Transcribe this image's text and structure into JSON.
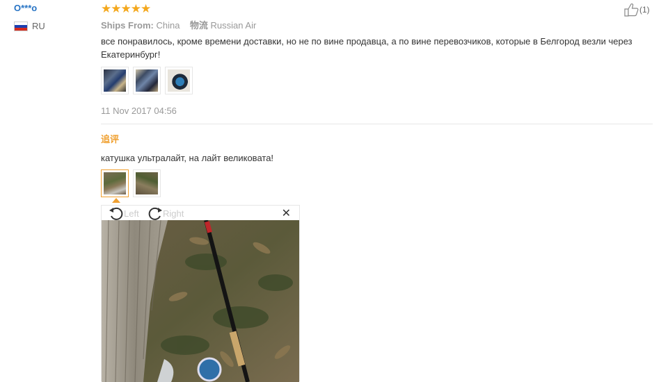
{
  "user": {
    "name": "O***o",
    "country": "RU"
  },
  "review": {
    "stars": "★★★★★",
    "rating": 5,
    "helpful_count": "(1)",
    "ships_from_label": "Ships From:",
    "ships_from_value": "China",
    "shipping_label": "物流",
    "shipping_value": "Russian Air",
    "text": "все понравилось, кроме времени доставки, но не по вине продавца, а по вине перевозчиков, которые в Белгород везли через Екатеринбург!",
    "date": "11 Nov 2017 04:56",
    "thumbnails": [
      "photo-1",
      "photo-2",
      "photo-3"
    ]
  },
  "followup": {
    "label": "追评",
    "text": "катушка ультралайт, на лайт великовата!",
    "thumbnails": [
      "photo-a",
      "photo-b"
    ]
  },
  "viewer": {
    "rotate_left_label": "Left",
    "rotate_right_label": "Right",
    "close_symbol": "✕"
  },
  "colors": {
    "accent": "#f0a030",
    "link": "#2673c4",
    "star": "#f4a81d"
  }
}
